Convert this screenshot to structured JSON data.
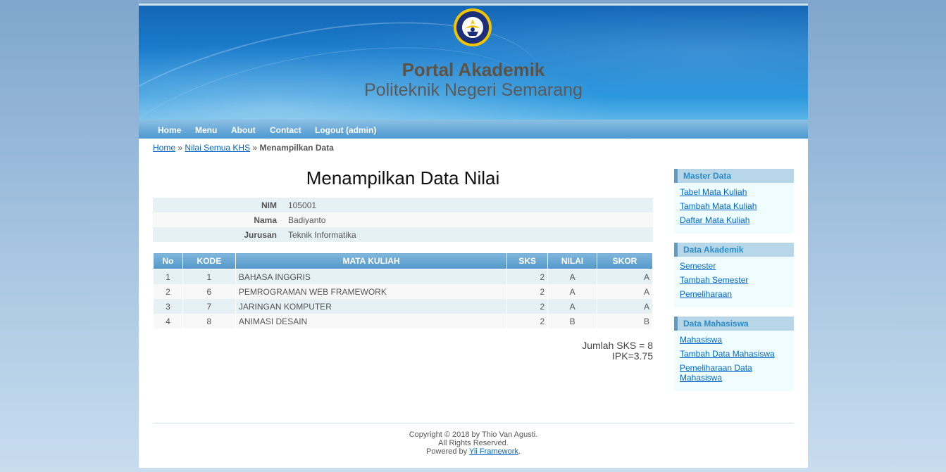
{
  "header": {
    "title": "Portal Akademik",
    "subtitle": "Politeknik Negeri Semarang",
    "logo_icon": "polines-logo-icon"
  },
  "menu": {
    "items": [
      "Home",
      "Menu",
      "About",
      "Contact",
      "Logout (admin)"
    ]
  },
  "breadcrumbs": {
    "home": "Home",
    "sep1": "»",
    "parent": "Nilai Semua KHS",
    "sep2": "»",
    "current": "Menampilkan Data"
  },
  "content": {
    "title": "Menampilkan Data Nilai",
    "detail": [
      {
        "label": "NIM",
        "value": "105001"
      },
      {
        "label": "Nama",
        "value": "Badiyanto"
      },
      {
        "label": "Jurusan",
        "value": "Teknik Informatika"
      }
    ],
    "table": {
      "headers": [
        "No",
        "KODE",
        "MATA KULIAH",
        "SKS",
        "NILAI",
        "SKOR"
      ],
      "rows": [
        {
          "no": "1",
          "kode": "1",
          "mata_kuliah": "BAHASA INGGRIS",
          "sks": "2",
          "nilai": "A",
          "skor": "A"
        },
        {
          "no": "2",
          "kode": "6",
          "mata_kuliah": "PEMROGRAMAN WEB FRAMEWORK",
          "sks": "2",
          "nilai": "A",
          "skor": "A"
        },
        {
          "no": "3",
          "kode": "7",
          "mata_kuliah": "JARINGAN KOMPUTER",
          "sks": "2",
          "nilai": "A",
          "skor": "A"
        },
        {
          "no": "4",
          "kode": "8",
          "mata_kuliah": "ANIMASI DESAIN",
          "sks": "2",
          "nilai": "B",
          "skor": "B"
        }
      ]
    },
    "summary": {
      "jumlah_sks": "Jumlah SKS = 8",
      "ipk": "IPK=3.75"
    }
  },
  "sidebar": {
    "portlets": [
      {
        "title": "Master Data",
        "links": [
          "Tabel Mata Kuliah",
          "Tambah Mata Kuliah",
          "Daftar Mata Kuliah"
        ]
      },
      {
        "title": "Data Akademik",
        "links": [
          "Semester",
          "Tambah Semester",
          "Pemeliharaan"
        ]
      },
      {
        "title": "Data Mahasiswa",
        "links": [
          "Mahasiswa",
          "Tambah Data Mahasiswa",
          "Pemeliharaan Data Mahasiswa"
        ]
      }
    ]
  },
  "footer": {
    "copyright": "Copyright © 2018 by Thio Van Agusti.",
    "rights": "All Rights Reserved.",
    "powered_prefix": "Powered by ",
    "powered_link": "Yii Framework",
    "powered_suffix": "."
  },
  "colors": {
    "header_blue": "#1b7fcf",
    "menu_blue": "#4e98cf",
    "link": "#0066cc",
    "portlet_title": "#298dcd"
  }
}
